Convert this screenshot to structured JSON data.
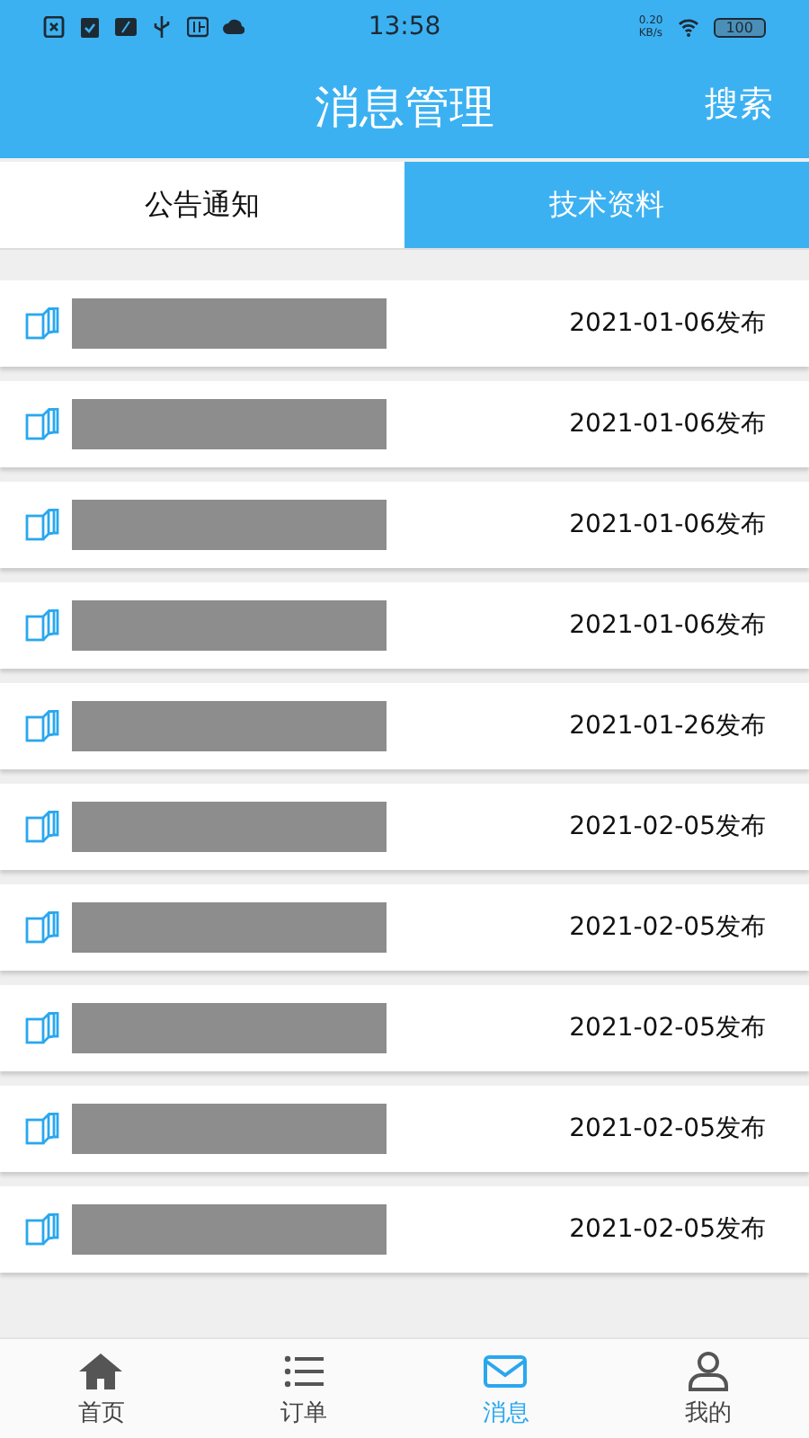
{
  "status_bar": {
    "time": "13:58",
    "speed": "0.20",
    "speed_unit": "KB/s",
    "battery": "100"
  },
  "header": {
    "title": "消息管理",
    "action": "搜索"
  },
  "tabs": [
    {
      "label": "公告通知",
      "selected": false
    },
    {
      "label": "技术资料",
      "selected": true
    }
  ],
  "messages": [
    {
      "date": "2021-01-06发布"
    },
    {
      "date": "2021-01-06发布"
    },
    {
      "date": "2021-01-06发布"
    },
    {
      "date": "2021-01-06发布"
    },
    {
      "date": "2021-01-26发布"
    },
    {
      "date": "2021-02-05发布"
    },
    {
      "date": "2021-02-05发布"
    },
    {
      "date": "2021-02-05发布"
    },
    {
      "date": "2021-02-05发布"
    },
    {
      "date": "2021-02-05发布"
    }
  ],
  "bottom_nav": [
    {
      "label": "首页",
      "kind": "home",
      "selected": false
    },
    {
      "label": "订单",
      "kind": "list",
      "selected": false
    },
    {
      "label": "消息",
      "kind": "mail",
      "selected": true
    },
    {
      "label": "我的",
      "kind": "person",
      "selected": false
    }
  ]
}
